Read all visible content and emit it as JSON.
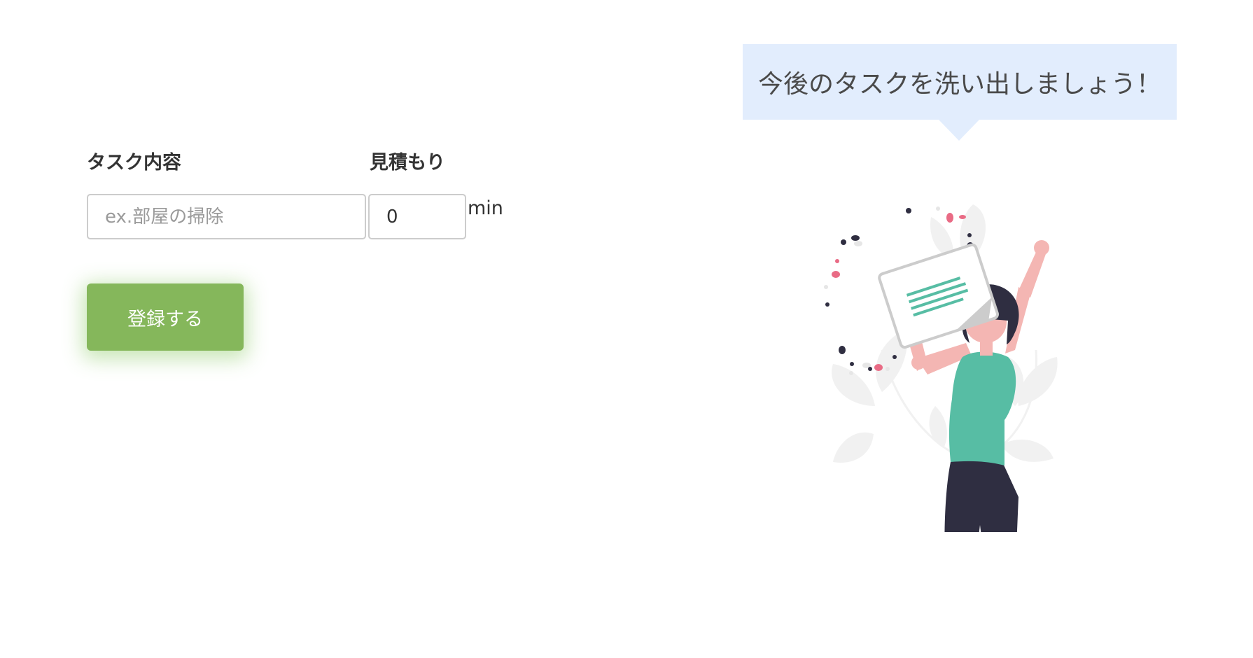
{
  "form": {
    "task_label": "タスク内容",
    "task_placeholder": "ex.部屋の掃除",
    "estimate_label": "見積もり",
    "estimate_value": "0",
    "unit": "min",
    "submit_label": "登録する"
  },
  "bubble": {
    "message": "今後のタスクを洗い出しましょう！"
  },
  "illustration": {
    "icon": "celebrating-woman-illustration",
    "colors": {
      "shirt": "#57bda4",
      "skin": "#f4b6b3",
      "hair_pants": "#2f2e41",
      "leaves": "#f1f1f1",
      "confetti_pink": "#e96b85"
    }
  },
  "colors": {
    "button": "#85b75b",
    "bubble": "#e2edfd"
  }
}
